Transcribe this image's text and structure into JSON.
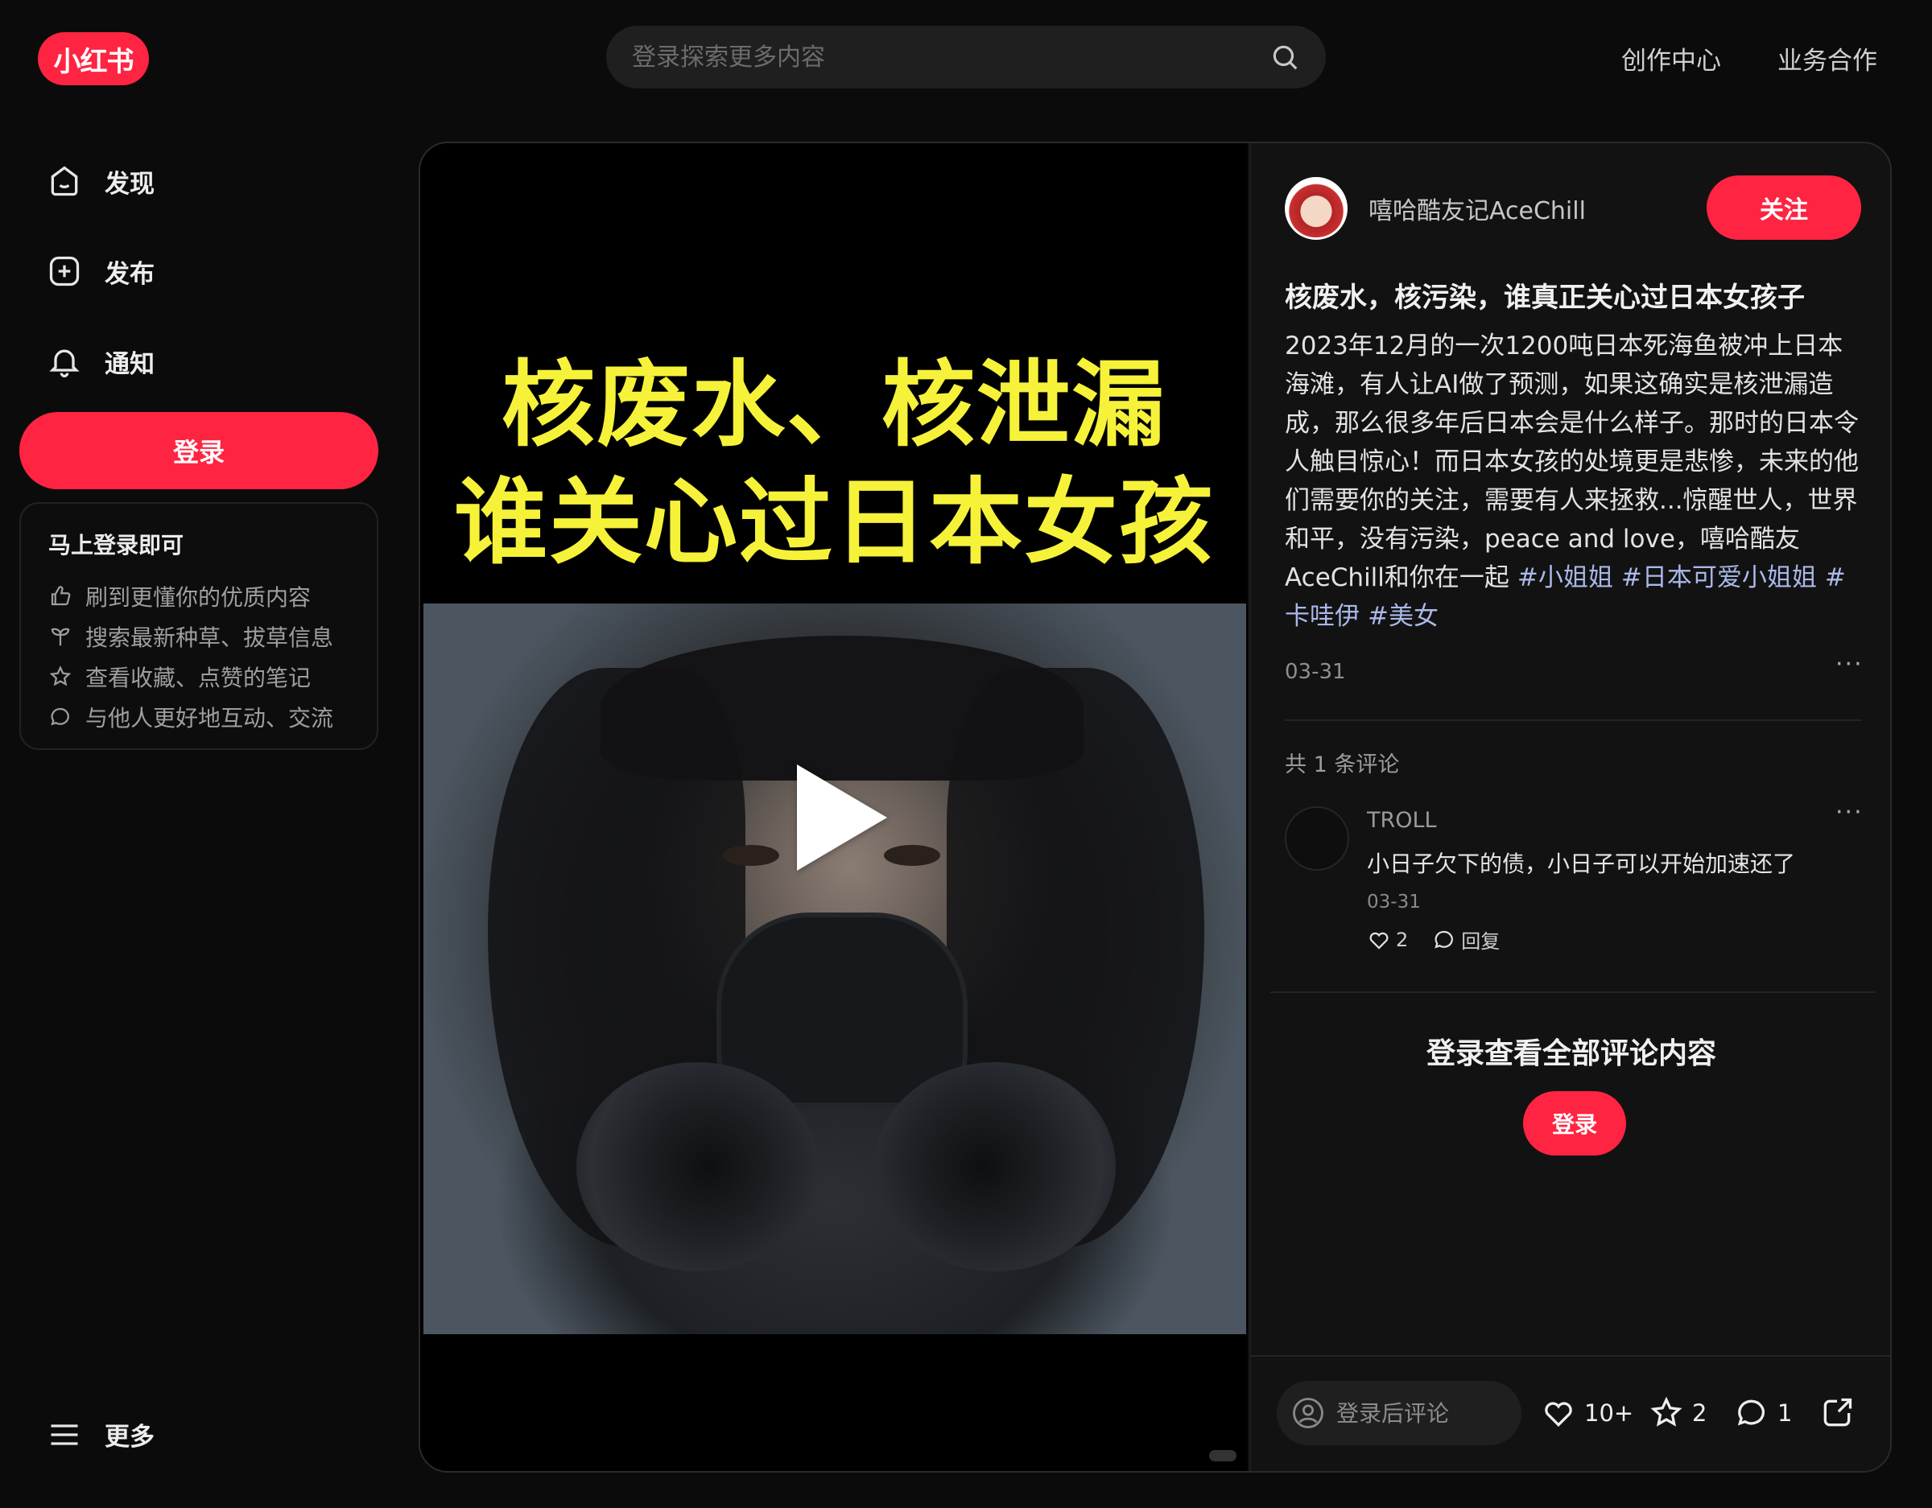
{
  "brand": {
    "logo_text": "小红书",
    "accent": "#ff2442"
  },
  "header": {
    "search_placeholder": "登录探索更多内容",
    "links": [
      "创作中心",
      "业务合作"
    ]
  },
  "sidebar": {
    "items": [
      {
        "label": "发现",
        "icon": "home-icon"
      },
      {
        "label": "发布",
        "icon": "plus-square-icon"
      },
      {
        "label": "通知",
        "icon": "bell-icon"
      }
    ],
    "login_label": "登录",
    "promo": {
      "title": "马上登录即可",
      "items": [
        {
          "text": "刷到更懂你的优质内容",
          "icon": "thumbs-up-icon"
        },
        {
          "text": "搜索最新种草、拔草信息",
          "icon": "sprout-icon"
        },
        {
          "text": "查看收藏、点赞的笔记",
          "icon": "star-icon"
        },
        {
          "text": "与他人更好地互动、交流",
          "icon": "chat-bubble-icon"
        }
      ]
    },
    "more_label": "更多"
  },
  "media": {
    "headline_line1": "核废水、核泄漏",
    "headline_line2": "谁关心过日本女孩"
  },
  "note": {
    "author": "嘻哈酷友记AceChill",
    "follow_label": "关注",
    "title": "核废水，核污染，谁真正关心过日本女孩子",
    "description": "2023年12月的一次1200吨日本死海鱼被冲上日本海滩，有人让AI做了预测，如果这确实是核泄漏造成，那么很多年后日本会是什么样子。那时的日本令人触目惊心！而日本女孩的处境更是悲惨，未来的他们需要你的关注，需要有人来拯救...惊醒世人，世界和平，没有污染，peace and love，嘻哈酷友AceChill和你在一起",
    "tags": [
      "#小姐姐",
      "#日本可爱小姐姐",
      "#卡哇伊",
      "#美女"
    ],
    "date": "03-31",
    "comment_count_text": "共 1 条评论",
    "comment": {
      "user": "TROLL",
      "text": "小日子欠下的债，小日子可以开始加速还了",
      "date": "03-31",
      "likes": "2",
      "reply_label": "回复"
    },
    "login_hint": "登录查看全部评论内容",
    "login_label": "登录",
    "comment_placeholder": "登录后评论",
    "stats": {
      "likes": "10+",
      "collects": "2",
      "comments": "1"
    }
  }
}
